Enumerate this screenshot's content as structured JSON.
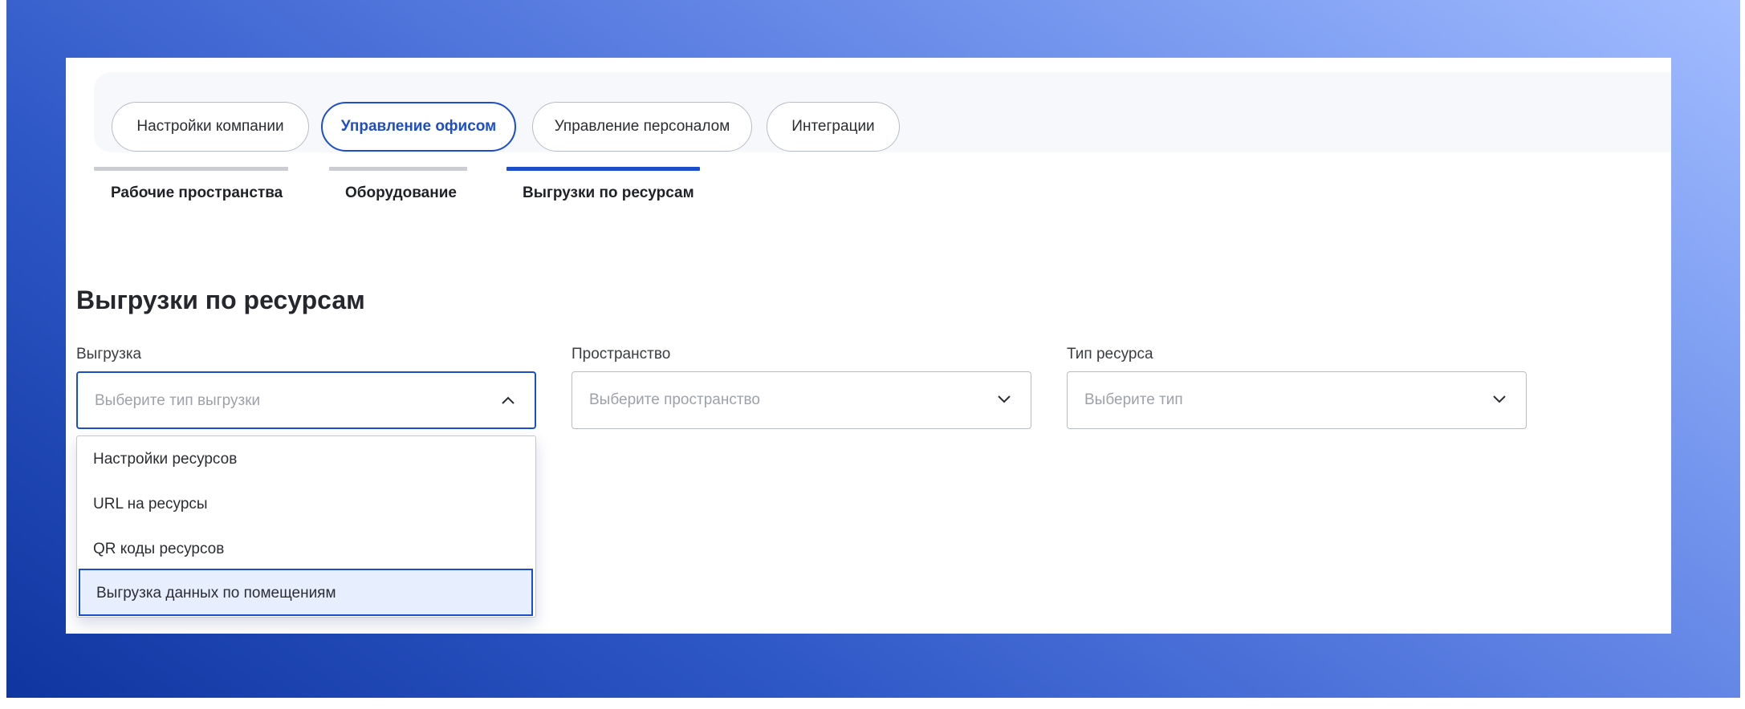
{
  "top_tabs": [
    {
      "label": "Настройки компании"
    },
    {
      "label": "Управление офисом",
      "active": true
    },
    {
      "label": "Управление персоналом"
    },
    {
      "label": "Интеграции"
    }
  ],
  "sub_tabs": [
    {
      "label": "Рабочие пространства"
    },
    {
      "label": "Оборудование"
    },
    {
      "label": "Выгрузки по ресурсам",
      "active": true
    }
  ],
  "page_title": "Выгрузки по ресурсам",
  "filters": {
    "export": {
      "label": "Выгрузка",
      "placeholder": "Выберите тип выгрузки",
      "open": true
    },
    "space": {
      "label": "Пространство",
      "placeholder": "Выберите пространство"
    },
    "resource_type": {
      "label": "Тип ресурса",
      "placeholder": "Выберите тип"
    }
  },
  "export_options": [
    {
      "label": "Настройки ресурсов"
    },
    {
      "label": "URL на ресурсы"
    },
    {
      "label": "QR коды ресурсов"
    },
    {
      "label": "Выгрузка данных по помещениям",
      "highlighted": true
    }
  ],
  "colors": {
    "accent": "#1d4ec9",
    "highlight_bg": "#e7efff",
    "backdrop_light": "#a2bcff",
    "backdrop_dark": "#0f35a0"
  },
  "icons": {
    "chevron_up": "chevron-up-icon",
    "chevron_down": "chevron-down-icon"
  }
}
